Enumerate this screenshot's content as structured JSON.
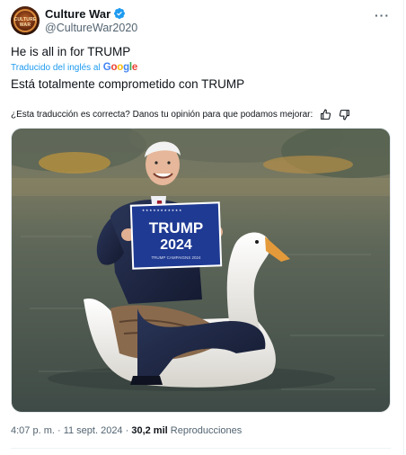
{
  "author": {
    "display_name": "Culture War",
    "handle": "@CultureWar2020",
    "avatar_text": "CULTURE WAR",
    "verified_icon": "verified-badge-icon"
  },
  "tweet": {
    "text": "He is all in for TRUMP",
    "translated_label": "Traducido del inglés al",
    "google_logo": "Google",
    "translation": "Está totalmente comprometido con TRUMP",
    "feedback_question": "¿Esta traducción es correcta? Danos tu opinión para que podamos mejorar:"
  },
  "image": {
    "sign_line1": "TRUMP",
    "sign_line2": "2024",
    "sign_small": "TRUMP CAMPAIGNS 2024",
    "colors": {
      "sign_blue": "#1f3a93",
      "water": "#4f5a52",
      "goose": "#f4f2ee"
    }
  },
  "meta": {
    "time": "4:07 p. m.",
    "sep1": " · ",
    "date": "11 sept. 2024",
    "sep2": " · ",
    "views_count": "30,2 mil",
    "views_label": " Reproducciones"
  },
  "colors": {
    "accent": "#1d9bf0",
    "text": "#0f1419",
    "muted": "#536471"
  }
}
